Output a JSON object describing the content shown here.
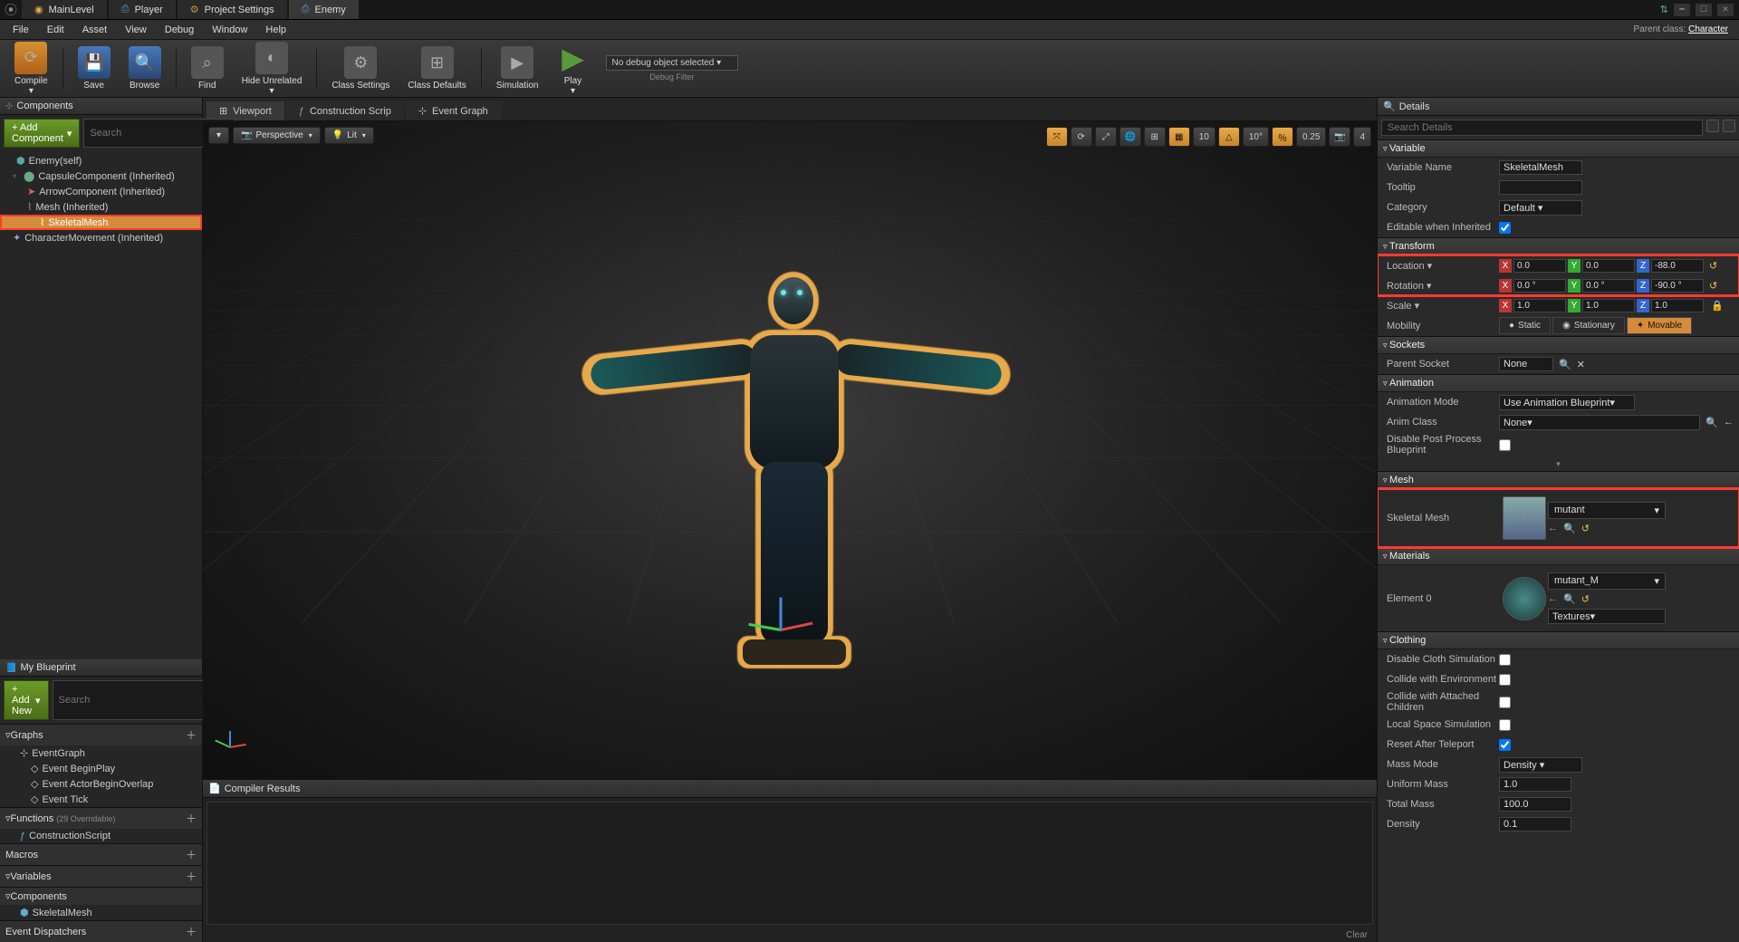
{
  "topTabs": [
    "MainLevel",
    "Player",
    "Project Settings",
    "Enemy"
  ],
  "topTabsActive": 3,
  "parentClassLabel": "Parent class:",
  "parentClass": "Character",
  "menu": [
    "File",
    "Edit",
    "Asset",
    "View",
    "Debug",
    "Window",
    "Help"
  ],
  "toolbar": {
    "compile": "Compile",
    "save": "Save",
    "browse": "Browse",
    "find": "Find",
    "hideUnrelated": "Hide Unrelated",
    "classSettings": "Class Settings",
    "classDefaults": "Class Defaults",
    "simulation": "Simulation",
    "play": "Play",
    "debugSelected": "No debug object selected",
    "debugFilter": "Debug Filter"
  },
  "componentsPanel": {
    "title": "Components",
    "addBtn": "+ Add Component",
    "searchPlaceholder": "Search",
    "root": "Enemy(self)",
    "items": [
      "CapsuleComponent (Inherited)",
      "ArrowComponent (Inherited)",
      "Mesh (Inherited)",
      "SkeletalMesh",
      "CharacterMovement (Inherited)"
    ]
  },
  "myBlueprint": {
    "title": "My Blueprint",
    "addBtn": "+ Add New",
    "searchPlaceholder": "Search",
    "graphs": {
      "title": "Graphs",
      "items": [
        "EventGraph",
        "Event BeginPlay",
        "Event ActorBeginOverlap",
        "Event Tick"
      ]
    },
    "functions": {
      "title": "Functions",
      "suffix": "(29 Overridable)",
      "items": [
        "ConstructionScript"
      ]
    },
    "macros": "Macros",
    "variables": "Variables",
    "components": {
      "title": "Components",
      "items": [
        "SkeletalMesh"
      ]
    },
    "eventDispatchers": "Event Dispatchers"
  },
  "centerTabs": {
    "viewport": "Viewport",
    "construction": "Construction Scrip",
    "eventGraph": "Event Graph"
  },
  "viewportToolbar": {
    "perspective": "Perspective",
    "lit": "Lit"
  },
  "viewportRight": {
    "grid": "10",
    "angle": "10°",
    "scale": "0.25",
    "cam": "4"
  },
  "compiler": {
    "title": "Compiler Results",
    "clear": "Clear"
  },
  "details": {
    "title": "Details",
    "searchPlaceholder": "Search Details",
    "variable": {
      "cat": "Variable",
      "name": "Variable Name",
      "nameVal": "SkeletalMesh",
      "tooltip": "Tooltip",
      "category": "Category",
      "categoryVal": "Default",
      "editable": "Editable when Inherited"
    },
    "transform": {
      "cat": "Transform",
      "location": "Location",
      "rotation": "Rotation",
      "scale": "Scale",
      "mobility": "Mobility",
      "loc": {
        "x": "0.0",
        "y": "0.0",
        "z": "-88.0"
      },
      "rot": {
        "x": "0.0 °",
        "y": "0.0 °",
        "z": "-90.0 °"
      },
      "scl": {
        "x": "1.0",
        "y": "1.0",
        "z": "1.0"
      },
      "mobOptions": [
        "Static",
        "Stationary",
        "Movable"
      ]
    },
    "sockets": {
      "cat": "Sockets",
      "parent": "Parent Socket",
      "none": "None"
    },
    "animation": {
      "cat": "Animation",
      "mode": "Animation Mode",
      "modeVal": "Use Animation Blueprint",
      "class": "Anim Class",
      "classVal": "None",
      "disablePP": "Disable Post Process Blueprint"
    },
    "mesh": {
      "cat": "Mesh",
      "skeletal": "Skeletal Mesh",
      "asset": "mutant"
    },
    "materials": {
      "cat": "Materials",
      "elem": "Element 0",
      "asset": "mutant_M",
      "textures": "Textures"
    },
    "clothing": {
      "cat": "Clothing",
      "disable": "Disable Cloth Simulation",
      "env": "Collide with Environment",
      "children": "Collide with Attached Children",
      "local": "Local Space Simulation",
      "reset": "Reset After Teleport",
      "massMode": "Mass Mode",
      "massModeVal": "Density",
      "uniformMass": "Uniform Mass",
      "uniformMassVal": "1.0",
      "totalMass": "Total Mass",
      "totalMassVal": "100.0",
      "density": "Density",
      "densityVal": "0.1"
    }
  }
}
